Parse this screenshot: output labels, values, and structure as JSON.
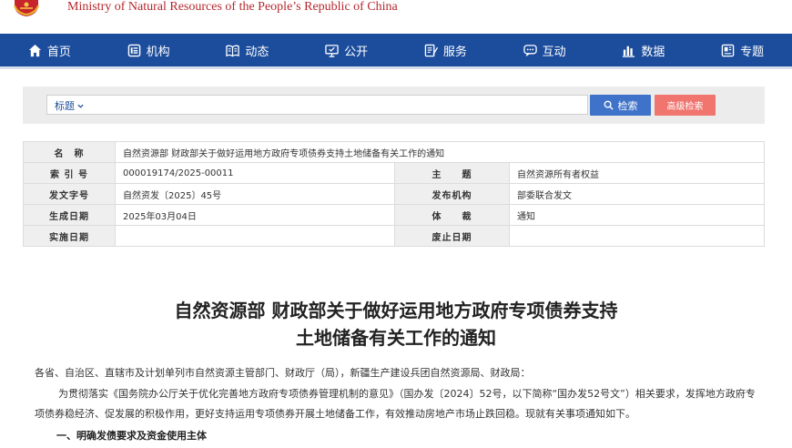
{
  "header": {
    "site_title": "Ministry of Natural Resources of the People’s Republic of China"
  },
  "nav": [
    {
      "label": "首页",
      "icon": "home-icon"
    },
    {
      "label": "机构",
      "icon": "org-icon"
    },
    {
      "label": "动态",
      "icon": "book-icon"
    },
    {
      "label": "公开",
      "icon": "monitor-icon"
    },
    {
      "label": "服务",
      "icon": "edit-doc-icon"
    },
    {
      "label": "互动",
      "icon": "chat-icon"
    },
    {
      "label": "数据",
      "icon": "bar-chart-icon"
    },
    {
      "label": "专题",
      "icon": "topic-icon"
    }
  ],
  "search": {
    "selector_label": "标题",
    "query": "",
    "search_label": "检索",
    "advanced_label": "高级检索"
  },
  "meta": {
    "name_label": "名　称",
    "name_value": "自然资源部 财政部关于做好运用地方政府专项债券支持土地储备有关工作的通知",
    "index_label": "索 引 号",
    "index_value": "000019174/2025-00011",
    "subject_label": "主　　题",
    "subject_value": "自然资源所有者权益",
    "docno_label": "发文字号",
    "docno_value": "自然资发〔2025〕45号",
    "issuer_label": "发布机构",
    "issuer_value": "部委联合发文",
    "date_label": "生成日期",
    "date_value": "2025年03月04日",
    "genre_label": "体　　裁",
    "genre_value": "通知",
    "effective_label": "实施日期",
    "effective_value": "",
    "repeal_label": "废止日期",
    "repeal_value": ""
  },
  "article": {
    "title_line1": "自然资源部 财政部关于做好运用地方政府专项债券支持",
    "title_line2": "土地储备有关工作的通知",
    "addressees": "各省、自治区、直辖市及计划单列市自然资源主管部门、财政厅（局），新疆生产建设兵团自然资源局、财政局：",
    "intro": "为贯彻落实《国务院办公厅关于优化完善地方政府专项债券管理机制的意见》（国办发〔2024〕52号，以下简称“国办发52号文”）相关要求，发挥地方政府专项债券稳经济、促发展的积极作用，更好支持运用专项债券开展土地储备工作，有效推动房地产市场止跌回稳。现就有关事项通知如下。",
    "section1": "一、明确发债要求及资金使用主体"
  },
  "colors": {
    "nav_bg": "#1c4d9c",
    "brand_red": "#b5282d",
    "search_btn": "#3f73c9",
    "advanced_btn": "#f0756f"
  }
}
